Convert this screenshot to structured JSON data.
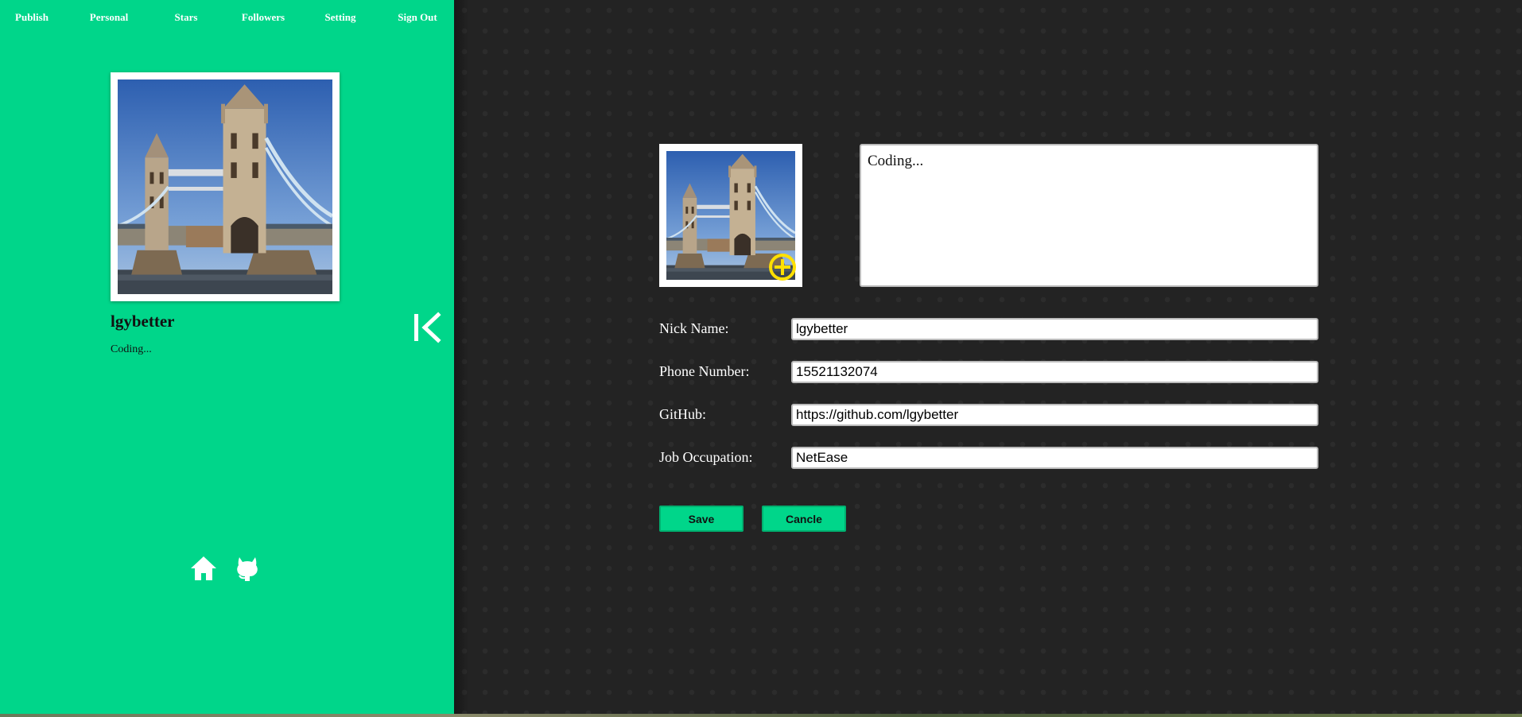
{
  "nav": {
    "items": [
      {
        "label": "Publish"
      },
      {
        "label": "Personal"
      },
      {
        "label": "Stars"
      },
      {
        "label": "Followers"
      },
      {
        "label": "Setting"
      },
      {
        "label": "Sign Out"
      }
    ]
  },
  "profile": {
    "username": "lgybetter",
    "bio": "Coding..."
  },
  "icons": {
    "collapse": "collapse-left-icon",
    "home": "home-icon",
    "github": "github-icon",
    "add_photo": "add-circle-icon"
  },
  "form": {
    "bio_value": "Coding...",
    "fields": [
      {
        "label": "Nick Name:",
        "value": "lgybetter"
      },
      {
        "label": "Phone Number:",
        "value": "15521132074"
      },
      {
        "label": "GitHub:",
        "value": "https://github.com/lgybetter"
      },
      {
        "label": "Job Occupation:",
        "value": "NetEase"
      }
    ],
    "save_label": "Save",
    "cancel_label": "Cancle"
  },
  "colors": {
    "accent": "#00d68a",
    "background": "#232323",
    "plus_icon": "#ffe000"
  }
}
